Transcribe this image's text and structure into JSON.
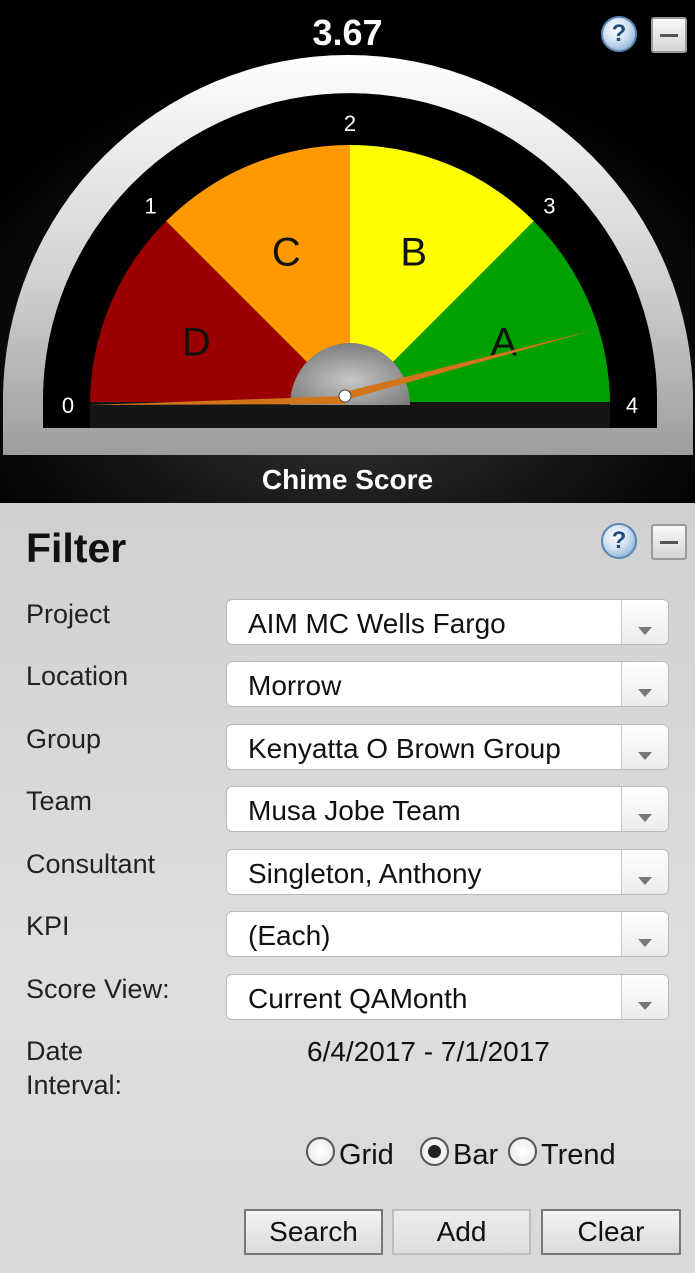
{
  "gauge": {
    "score": "3.67",
    "score_value": 3.67,
    "caption": "Chime Score",
    "min": 0,
    "max": 4,
    "ticks": [
      "0",
      "1",
      "2",
      "3",
      "4"
    ],
    "bands": [
      {
        "grade": "D",
        "from": 0,
        "to": 1,
        "color": "#9a0000"
      },
      {
        "grade": "C",
        "from": 1,
        "to": 2,
        "color": "#ff9900"
      },
      {
        "grade": "B",
        "from": 2,
        "to": 3,
        "color": "#ffff00"
      },
      {
        "grade": "A",
        "from": 3,
        "to": 4,
        "color": "#00a000"
      }
    ],
    "needle_color": "#d2751a"
  },
  "filter": {
    "title": "Filter",
    "fields": [
      {
        "label": "Project",
        "value": "AIM MC Wells Fargo"
      },
      {
        "label": "Location",
        "value": "Morrow"
      },
      {
        "label": "Group",
        "value": "Kenyatta O Brown Group"
      },
      {
        "label": "Team",
        "value": "Musa Jobe Team"
      },
      {
        "label": "Consultant",
        "value": "Singleton, Anthony"
      },
      {
        "label": "KPI",
        "value": "(Each)"
      },
      {
        "label": "Score View:",
        "value": "Current QAMonth"
      }
    ],
    "date_label_line1": "Date",
    "date_label_line2": "Interval:",
    "date_value": "6/4/2017 - 7/1/2017",
    "view_options": [
      {
        "label": "Grid",
        "checked": false
      },
      {
        "label": "Bar",
        "checked": true
      },
      {
        "label": "Trend",
        "checked": false
      }
    ],
    "buttons": {
      "search": "Search",
      "add": "Add",
      "clear": "Clear"
    }
  },
  "icons": {
    "help": "?",
    "help_name": "help-icon",
    "minimize_name": "minimize-icon"
  }
}
